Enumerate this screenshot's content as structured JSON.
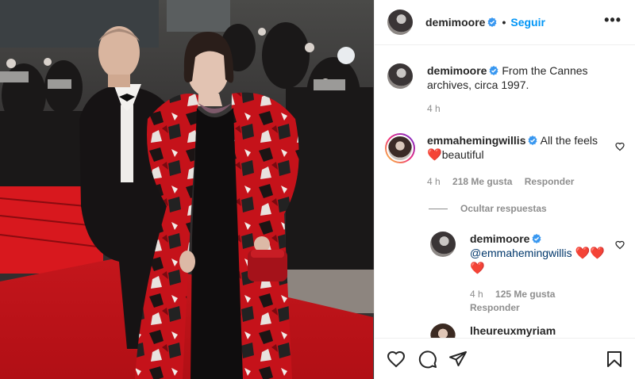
{
  "post": {
    "username": "demimoore",
    "follow_label": "Seguir",
    "more_label": "•••",
    "separator": "•"
  },
  "caption": {
    "username": "demimoore",
    "text": "From the Cannes archives, circa 1997.",
    "time": "4 h"
  },
  "comments": [
    {
      "username": "emmahemingwillis",
      "text": "All the feels",
      "text2": "beautiful",
      "time": "4 h",
      "likes": "218 Me gusta",
      "reply": "Responder"
    }
  ],
  "hide_replies": "Ocultar respuestas",
  "reply": {
    "username": "demimoore",
    "mention": "@emmahemingwillis",
    "time": "4 h",
    "likes": "125 Me gusta",
    "reply": "Responder"
  },
  "next_comment": {
    "username": "lheureuxmyriam"
  },
  "icons": {
    "verified": "verified-badge-icon",
    "like": "heart-icon",
    "comment": "comment-icon",
    "share": "share-icon",
    "save": "bookmark-icon",
    "emoji": "red-heart-emoji"
  },
  "colors": {
    "link_blue": "#0095f6",
    "mention_blue": "#00376b",
    "secondary_text": "#8e8e8e",
    "heart_red": "#e0141e"
  }
}
